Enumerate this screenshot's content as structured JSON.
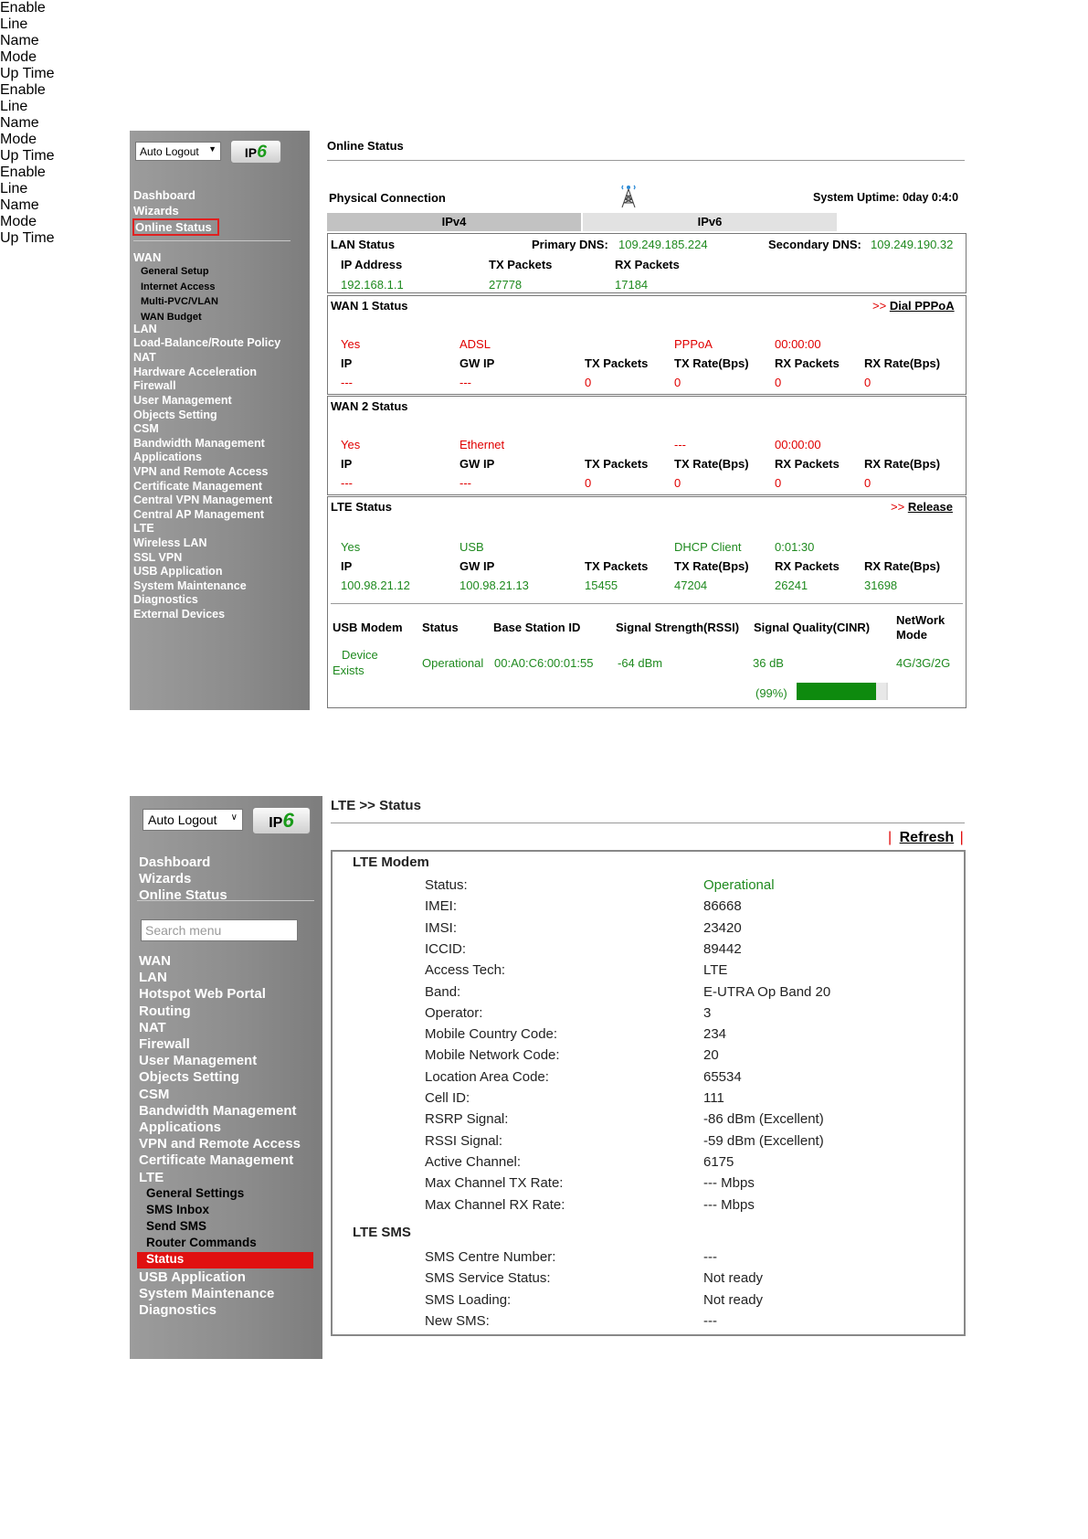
{
  "screen1": {
    "auto_logout": "Auto Logout",
    "ipv6_logo": "IPv6",
    "menu": {
      "dashboard": "Dashboard",
      "wizards": "Wizards",
      "online_status": "Online Status",
      "wan": "WAN",
      "wan_sub": [
        "General Setup",
        "Internet Access",
        "Multi-PVC/VLAN",
        "WAN Budget"
      ],
      "items": [
        "LAN",
        "Load-Balance/Route Policy",
        "NAT",
        "Hardware Acceleration",
        "Firewall",
        "User Management",
        "Objects Setting",
        "CSM",
        "Bandwidth Management",
        "Applications",
        "VPN and Remote Access",
        "Certificate Management",
        "Central VPN Management",
        "Central AP Management",
        "LTE",
        "Wireless LAN",
        "SSL VPN",
        "USB Application",
        "System Maintenance",
        "Diagnostics",
        "External Devices"
      ]
    },
    "page_title": "Online Status",
    "physical_connection": "Physical Connection",
    "system_uptime": "System Uptime: 0day 0:4:0",
    "tabs": [
      "IPv4",
      "IPv6"
    ],
    "lan": {
      "title": "LAN Status",
      "primary_dns_label": "Primary DNS:",
      "primary_dns": "109.249.185.224",
      "secondary_dns_label": "Secondary DNS:",
      "secondary_dns": "109.249.190.32",
      "headers": [
        "IP Address",
        "TX Packets",
        "RX Packets"
      ],
      "values": [
        "192.168.1.1",
        "27778",
        "17184"
      ]
    },
    "wan1": {
      "title": "WAN 1 Status",
      "action_prefix": ">>",
      "action": "Dial PPPoA",
      "headers1": [
        "Enable",
        "Line",
        "Name",
        "Mode",
        "Up Time"
      ],
      "values1": [
        "Yes",
        "ADSL",
        "",
        "PPPoA",
        "00:00:00"
      ],
      "headers2": [
        "IP",
        "GW IP",
        "TX Packets",
        "TX Rate(Bps)",
        "RX Packets",
        "RX Rate(Bps)"
      ],
      "values2": [
        "---",
        "---",
        "0",
        "0",
        "0",
        "0"
      ]
    },
    "wan2": {
      "title": "WAN 2 Status",
      "headers1": [
        "Enable",
        "Line",
        "Name",
        "Mode",
        "Up Time"
      ],
      "values1": [
        "Yes",
        "Ethernet",
        "",
        "---",
        "00:00:00"
      ],
      "headers2": [
        "IP",
        "GW IP",
        "TX Packets",
        "TX Rate(Bps)",
        "RX Packets",
        "RX Rate(Bps)"
      ],
      "values2": [
        "---",
        "---",
        "0",
        "0",
        "0",
        "0"
      ]
    },
    "lte": {
      "title": "LTE Status",
      "action_prefix": ">>",
      "action": "Release",
      "headers1": [
        "Enable",
        "Line",
        "Name",
        "Mode",
        "Up Time"
      ],
      "values1": [
        "Yes",
        "USB",
        "",
        "DHCP Client",
        "0:01:30"
      ],
      "headers2": [
        "IP",
        "GW IP",
        "TX Packets",
        "TX Rate(Bps)",
        "RX Packets",
        "RX Rate(Bps)"
      ],
      "values2": [
        "100.98.21.12",
        "100.98.21.13",
        "15455",
        "47204",
        "26241",
        "31698"
      ],
      "modem_headers": [
        "USB Modem",
        "Status",
        "Base Station ID",
        "Signal Strength(RSSI)",
        "Signal Quality(CINR)",
        "NetWork",
        "Mode"
      ],
      "modem_values": [
        "Device",
        "Exists",
        "Operational",
        "00:A0:C6:00:01:55",
        "-64 dBm",
        "36 dB",
        "4G/3G/2G"
      ],
      "signal_percent_text": "(99%)",
      "signal_level": 0.99
    }
  },
  "screen2": {
    "auto_logout": "Auto Logout",
    "ipv6_logo": "IPv6",
    "menu": {
      "top": [
        "Dashboard",
        "Wizards",
        "Online Status"
      ],
      "search_placeholder": "Search menu",
      "items": [
        "WAN",
        "LAN",
        "Hotspot Web Portal",
        "Routing",
        "NAT",
        "Firewall",
        "User Management",
        "Objects Setting",
        "CSM",
        "Bandwidth Management",
        "Applications",
        "VPN and Remote Access",
        "Certificate Management",
        "LTE"
      ],
      "lte_sub": [
        "General Settings",
        "SMS Inbox",
        "Send SMS",
        "Router Commands",
        "Status"
      ],
      "after": [
        "USB Application",
        "System Maintenance",
        "Diagnostics"
      ]
    },
    "page_title": "LTE >> Status",
    "refresh_sep": "|",
    "refresh": "Refresh",
    "modem_section": "LTE Modem",
    "modem_rows": [
      {
        "label": "Status:",
        "value": "Operational"
      },
      {
        "label": "IMEI:",
        "value": "86668"
      },
      {
        "label": "IMSI:",
        "value": "23420"
      },
      {
        "label": "ICCID:",
        "value": "89442"
      },
      {
        "label": "Access Tech:",
        "value": "LTE"
      },
      {
        "label": "Band:",
        "value": "E-UTRA Op Band 20"
      },
      {
        "label": "Operator:",
        "value": "3"
      },
      {
        "label": "Mobile Country Code:",
        "value": "234"
      },
      {
        "label": "Mobile Network Code:",
        "value": "20"
      },
      {
        "label": "Location Area Code:",
        "value": "65534"
      },
      {
        "label": "Cell ID:",
        "value": "111"
      },
      {
        "label": "RSRP Signal:",
        "value": "-86 dBm (Excellent)"
      },
      {
        "label": "RSSI Signal:",
        "value": "-59 dBm (Excellent)"
      },
      {
        "label": "Active Channel:",
        "value": "6175"
      },
      {
        "label": "Max Channel TX Rate:",
        "value": "--- Mbps"
      },
      {
        "label": "Max Channel RX Rate:",
        "value": "--- Mbps"
      }
    ],
    "sms_section": "LTE SMS",
    "sms_rows": [
      {
        "label": "SMS Centre Number:",
        "value": "---"
      },
      {
        "label": "SMS Service Status:",
        "value": "Not ready"
      },
      {
        "label": "SMS Loading:",
        "value": "Not ready"
      },
      {
        "label": "New SMS:",
        "value": "---"
      }
    ]
  }
}
